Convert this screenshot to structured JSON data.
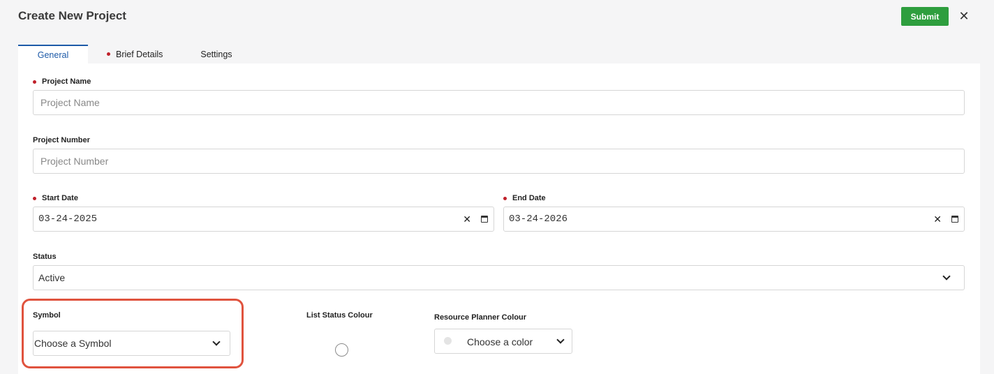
{
  "header": {
    "title": "Create New Project",
    "submit_label": "Submit",
    "close_glyph": "✕"
  },
  "tabs": [
    {
      "label": "General",
      "active": true,
      "required": false
    },
    {
      "label": "Brief Details",
      "active": false,
      "required": true
    },
    {
      "label": "Settings",
      "active": false,
      "required": false
    }
  ],
  "form": {
    "project_name": {
      "label": "Project Name",
      "required": true,
      "placeholder": "Project Name",
      "value": ""
    },
    "project_number": {
      "label": "Project Number",
      "required": false,
      "placeholder": "Project Number",
      "value": ""
    },
    "start_date": {
      "label": "Start Date",
      "required": true,
      "value": "03-24-2025"
    },
    "end_date": {
      "label": "End Date",
      "required": true,
      "value": "03-24-2026"
    },
    "status": {
      "label": "Status",
      "value": "Active"
    },
    "symbol": {
      "label": "Symbol",
      "value": "Choose a Symbol"
    },
    "list_status_colour": {
      "label": "List Status Colour"
    },
    "resource_planner_colour": {
      "label": "Resource Planner Colour",
      "value": "Choose a color"
    }
  },
  "colors": {
    "accent": "#1d5aa8",
    "submit": "#2e9e3e",
    "required": "#c0202a",
    "highlight": "#e0533e"
  },
  "icons": {
    "clear": "close-icon",
    "calendar": "calendar-icon",
    "dropdown": "chevron-down-icon"
  }
}
